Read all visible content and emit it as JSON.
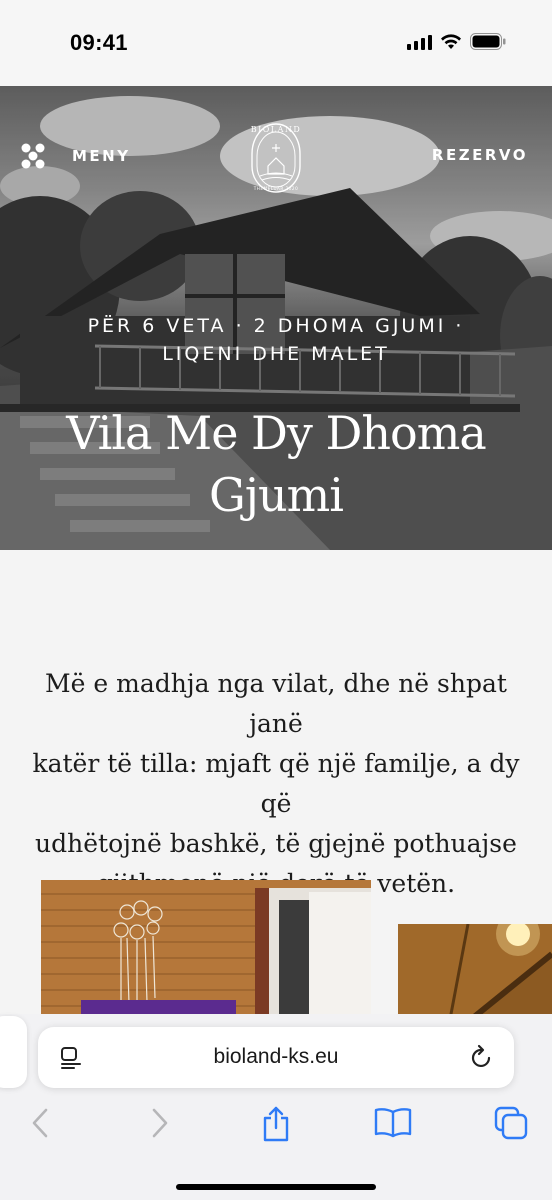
{
  "status_bar": {
    "time": "09:41"
  },
  "header": {
    "menu_label": "MENY",
    "book_label": "REZERVO",
    "logo_text": "BIOLAND",
    "logo_subtext": "THEMELUAR 2020"
  },
  "hero": {
    "subtitle_line1": "PËR 6 VETA · 2 DHOMA GJUMI ·",
    "subtitle_line2": "LIQENI DHE MALET",
    "title_line1": "Vila Me Dy Dhoma",
    "title_line2": "Gjumi"
  },
  "intro": {
    "line1": "Më e madhja nga vilat, dhe në shpat janë",
    "line2": "katër të tilla: mjaft që një familje, a dy që",
    "line3": "udhëtojnë bashkë, të gjejnë pothuajse",
    "line4": "gjithmonë një derë të vetën."
  },
  "browser": {
    "url": "bioland-ks.eu",
    "icons": [
      "reader-icon",
      "reload-icon",
      "back-icon",
      "forward-icon",
      "share-icon",
      "bookmarks-icon",
      "tabs-icon"
    ]
  },
  "colors": {
    "accent_blue": "#2f7bf6",
    "disabled_gray": "#b6b6b8"
  }
}
